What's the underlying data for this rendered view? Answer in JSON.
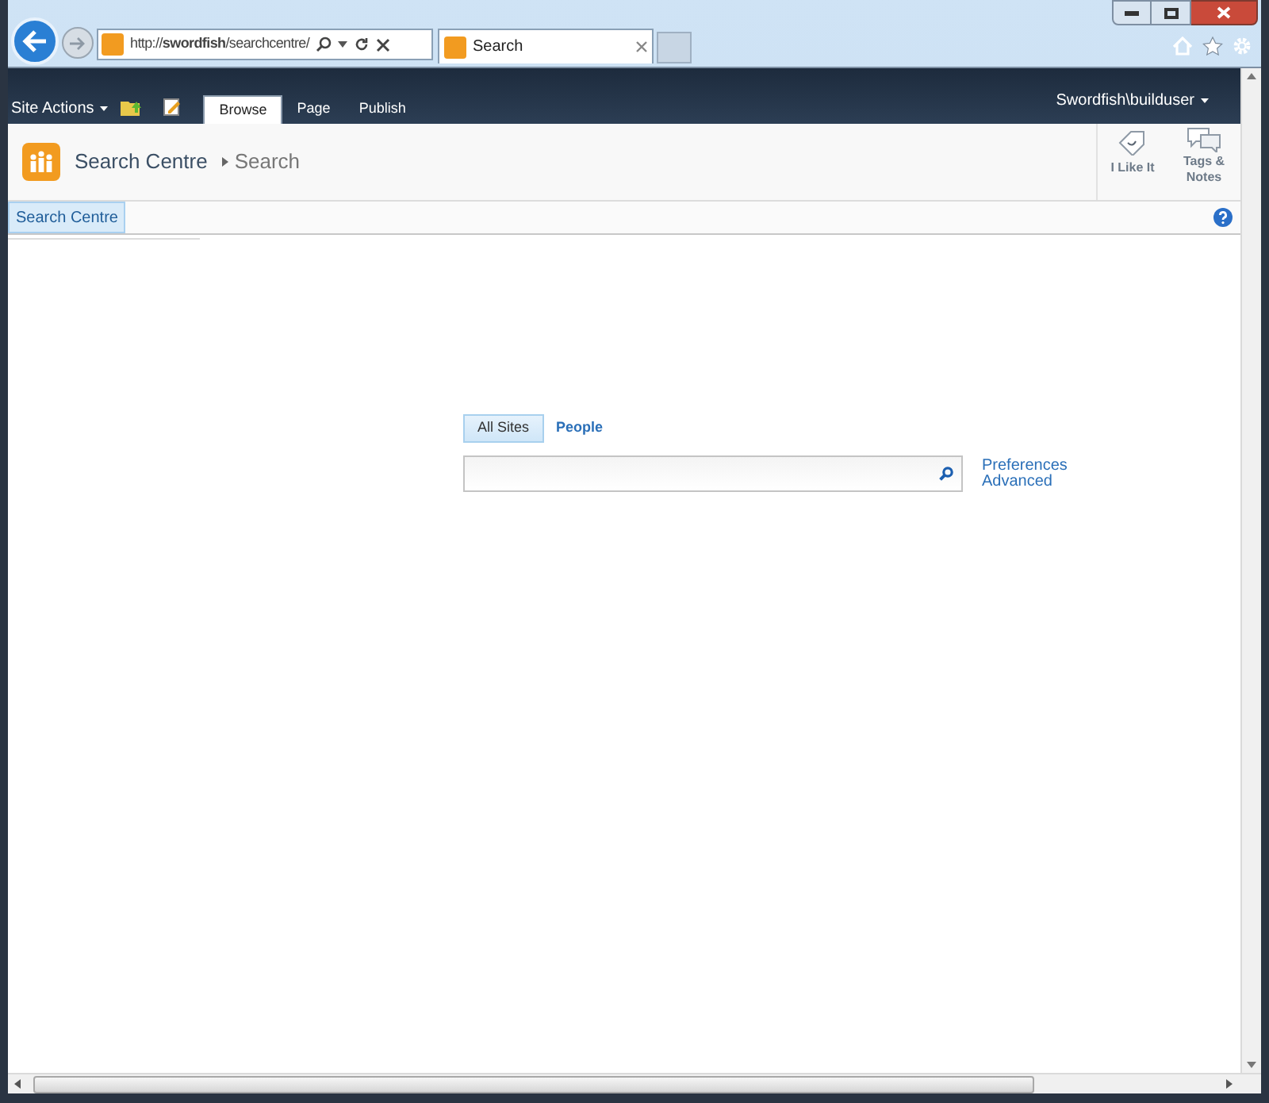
{
  "browser": {
    "address": "http://**swordfish**/searchcentre/",
    "tab_title": "Search"
  },
  "ribbon": {
    "site_actions": "Site Actions",
    "tabs": [
      {
        "label": "Browse",
        "selected": true
      },
      {
        "label": "Page",
        "selected": false
      },
      {
        "label": "Publish",
        "selected": false
      }
    ],
    "user": "Swordfish\\builduser"
  },
  "title": {
    "site": "Search Centre",
    "page": "Search"
  },
  "actions": [
    "I Like It",
    "Tags & Notes"
  ],
  "nav": [
    {
      "label": "Search Centre",
      "selected": true
    }
  ],
  "scopes": [
    {
      "label": "All Sites",
      "selected": true
    },
    {
      "label": "People",
      "selected": false
    }
  ],
  "links": [
    "Preferences",
    "Advanced"
  ]
}
